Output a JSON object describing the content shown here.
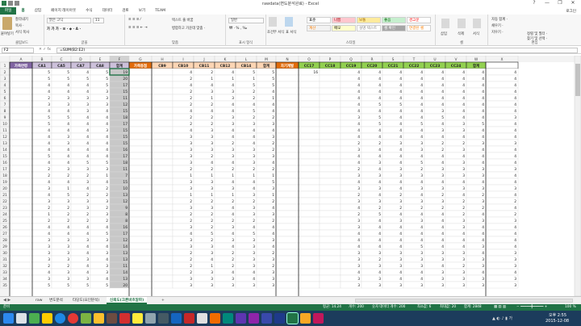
{
  "window": {
    "title": "rawdata(변도분석완료) - Excel",
    "qat_icons": [
      "save-icon",
      "undo-icon",
      "redo-icon"
    ],
    "controls": [
      "?",
      "—",
      "❐",
      "✕"
    ],
    "user": "로그인"
  },
  "menu": [
    "파일",
    "홈",
    "삽입",
    "페이지 레이아웃",
    "수식",
    "데이터",
    "검토",
    "보기",
    "TEAM"
  ],
  "ribbon": {
    "clipboard": {
      "label": "클립보드",
      "cut": "잘라내기",
      "copy": "복사 ·",
      "paste": "붙여넣기",
      "painter": "서식 복사"
    },
    "font": {
      "label": "글꼴",
      "name": "맑은 고딕",
      "size": "11"
    },
    "align": {
      "label": "맞춤",
      "wrap": "텍스트 줄 바꿈",
      "merge": "병합하고 가운데 맞춤 ·"
    },
    "number": {
      "label": "표시 형식",
      "format": "일반"
    },
    "styles": {
      "label": "스타일",
      "cond": "조건부 서식",
      "table": "표 서식",
      "cells": [
        {
          "text": "표준",
          "bg": "#ffffff",
          "fg": "#000000"
        },
        {
          "text": "나쁨",
          "bg": "#ffc7ce",
          "fg": "#9c0006"
        },
        {
          "text": "보통",
          "bg": "#ffeb9c",
          "fg": "#9c6500"
        },
        {
          "text": "좋음",
          "bg": "#c6efce",
          "fg": "#006100"
        },
        {
          "text": "경고문",
          "bg": "#ffffff",
          "fg": "#ff0000"
        },
        {
          "text": "계산",
          "bg": "#f2f2f2",
          "fg": "#fa7d00"
        },
        {
          "text": "메모",
          "bg": "#ffffcc",
          "fg": "#000000"
        },
        {
          "text": "설명 텍스트",
          "bg": "#ffffff",
          "fg": "#7f7f7f"
        },
        {
          "text": "셀 확인",
          "bg": "#a5a5a5",
          "fg": "#ffffff"
        },
        {
          "text": "연결된 셀",
          "bg": "#ffffff",
          "fg": "#fa7d00"
        }
      ]
    },
    "cells": {
      "label": "셀",
      "insert": "삽입",
      "delete": "삭제",
      "format": "서식"
    },
    "editing": {
      "label": "편집",
      "autosum": "자동 합계 ·",
      "fill": "채우기 ·",
      "clear": "지우기 ·",
      "sort": "정렬 및 필터 ·",
      "find": "찾기 및 선택 ·"
    }
  },
  "formula_bar": {
    "name_box": "F2",
    "formula": "=SUM(B2:E2)"
  },
  "grid": {
    "columns": [
      "A",
      "B",
      "C",
      "D",
      "E",
      "F",
      "G",
      "H",
      "I",
      "J",
      "K",
      "L",
      "M",
      "N",
      "O",
      "P",
      "Q",
      "R",
      "S",
      "T",
      "U",
      "V",
      "W",
      "X"
    ],
    "headers": [
      "가족연령",
      "CA1",
      "CA5",
      "CA7",
      "CA8",
      "합계",
      "가족동점",
      "CB9",
      "CB10",
      "CB11",
      "CB12",
      "CB14",
      "합계",
      "자기계발",
      "CC17",
      "CC18",
      "CC19",
      "CC20",
      "CC21",
      "CC22",
      "CC23",
      "CC24",
      "합계",
      ""
    ],
    "header_colors": [
      "#8064a2",
      "#ccc0da",
      "#ccc0da",
      "#ccc0da",
      "#ccc0da",
      "#ccc0da",
      "#e26b0a",
      "#fcd5b4",
      "#fcd5b4",
      "#fcd5b4",
      "#fcd5b4",
      "#fcd5b4",
      "#fcd5b4",
      "#e26b0a",
      "#92d050",
      "#92d050",
      "#92d050",
      "#92d050",
      "#92d050",
      "#92d050",
      "#92d050",
      "#92d050",
      "#92d050",
      "#ffffff"
    ],
    "row_numbers": [
      1,
      2,
      3,
      4,
      5,
      6,
      7,
      8,
      9,
      10,
      11,
      12,
      13,
      14,
      15,
      16,
      17,
      18,
      19,
      20,
      21,
      22,
      23,
      24,
      25,
      26,
      27,
      28,
      29,
      30,
      31,
      32,
      33,
      34,
      35
    ],
    "rows": [
      [
        "5",
        "5",
        "4",
        "5",
        "19",
        "",
        "4",
        "2",
        "4",
        "5",
        "5",
        "16",
        "",
        "4",
        "4",
        "4",
        "4",
        "4",
        "4",
        "4",
        "4",
        "10"
      ],
      [
        "5",
        "5",
        "5",
        "5",
        "20",
        "",
        "2",
        "1",
        "1",
        "1",
        "5",
        "",
        "",
        "4",
        "4",
        "4",
        "4",
        "4",
        "4",
        "4",
        "4",
        ""
      ],
      [
        "4",
        "4",
        "4",
        "5",
        "17",
        "",
        "4",
        "4",
        "4",
        "5",
        "5",
        "",
        "",
        "4",
        "4",
        "4",
        "4",
        "4",
        "4",
        "4",
        "4",
        ""
      ],
      [
        "4",
        "4",
        "4",
        "3",
        "15",
        "",
        "2",
        "3",
        "3",
        "2",
        "4",
        "",
        "",
        "4",
        "4",
        "4",
        "4",
        "4",
        "4",
        "4",
        "4",
        ""
      ],
      [
        "2",
        "3",
        "3",
        "3",
        "11",
        "",
        "2",
        "1",
        "3",
        "2",
        "1",
        "",
        "",
        "4",
        "4",
        "4",
        "4",
        "4",
        "4",
        "4",
        "4",
        ""
      ],
      [
        "3",
        "3",
        "3",
        "3",
        "12",
        "",
        "2",
        "2",
        "4",
        "4",
        "4",
        "",
        "",
        "4",
        "5",
        "5",
        "4",
        "4",
        "4",
        "4",
        "4",
        ""
      ],
      [
        "4",
        "4",
        "3",
        "4",
        "15",
        "",
        "4",
        "4",
        "4",
        "5",
        "4",
        "",
        "",
        "4",
        "4",
        "4",
        "4",
        "3",
        "4",
        "4",
        "4",
        ""
      ],
      [
        "5",
        "5",
        "4",
        "4",
        "18",
        "",
        "2",
        "2",
        "3",
        "2",
        "2",
        "",
        "",
        "3",
        "5",
        "4",
        "4",
        "5",
        "4",
        "4",
        "3",
        ""
      ],
      [
        "5",
        "4",
        "4",
        "4",
        "17",
        "",
        "2",
        "2",
        "3",
        "3",
        "3",
        "",
        "",
        "4",
        "5",
        "4",
        "5",
        "4",
        "3",
        "5",
        "4",
        ""
      ],
      [
        "4",
        "4",
        "4",
        "3",
        "15",
        "",
        "4",
        "3",
        "4",
        "4",
        "4",
        "",
        "",
        "4",
        "4",
        "4",
        "4",
        "3",
        "3",
        "4",
        "4",
        ""
      ],
      [
        "4",
        "3",
        "4",
        "4",
        "15",
        "",
        "3",
        "3",
        "4",
        "4",
        "3",
        "",
        "",
        "4",
        "4",
        "4",
        "4",
        "4",
        "4",
        "4",
        "4",
        ""
      ],
      [
        "4",
        "3",
        "4",
        "4",
        "15",
        "",
        "3",
        "3",
        "2",
        "4",
        "2",
        "",
        "",
        "2",
        "2",
        "3",
        "3",
        "2",
        "2",
        "3",
        "3",
        ""
      ],
      [
        "4",
        "4",
        "4",
        "4",
        "16",
        "",
        "3",
        "3",
        "3",
        "3",
        "2",
        "",
        "",
        "3",
        "4",
        "4",
        "3",
        "2",
        "3",
        "4",
        "4",
        ""
      ],
      [
        "5",
        "4",
        "4",
        "4",
        "17",
        "",
        "3",
        "2",
        "3",
        "3",
        "3",
        "",
        "",
        "4",
        "4",
        "4",
        "4",
        "4",
        "4",
        "4",
        "4",
        ""
      ],
      [
        "4",
        "4",
        "5",
        "5",
        "18",
        "",
        "3",
        "4",
        "4",
        "3",
        "4",
        "",
        "",
        "4",
        "3",
        "4",
        "5",
        "4",
        "3",
        "4",
        "4",
        ""
      ],
      [
        "2",
        "3",
        "3",
        "3",
        "11",
        "",
        "2",
        "2",
        "2",
        "2",
        "2",
        "",
        "",
        "2",
        "4",
        "3",
        "2",
        "3",
        "3",
        "3",
        "3",
        ""
      ],
      [
        "2",
        "2",
        "2",
        "1",
        "7",
        "",
        "1",
        "1",
        "1",
        "1",
        "1",
        "",
        "",
        "3",
        "3",
        "3",
        "3",
        "3",
        "3",
        "3",
        "4",
        ""
      ],
      [
        "4",
        "4",
        "3",
        "4",
        "15",
        "",
        "3",
        "3",
        "4",
        "4",
        "5",
        "",
        "",
        "4",
        "4",
        "4",
        "4",
        "4",
        "4",
        "4",
        "4",
        ""
      ],
      [
        "3",
        "1",
        "4",
        "2",
        "10",
        "",
        "3",
        "3",
        "3",
        "4",
        "3",
        "",
        "",
        "3",
        "3",
        "4",
        "3",
        "3",
        "3",
        "3",
        "3",
        ""
      ],
      [
        "4",
        "5",
        "2",
        "2",
        "13",
        "",
        "1",
        "1",
        "1",
        "3",
        "1",
        "",
        "",
        "2",
        "4",
        "2",
        "4",
        "2",
        "4",
        "2",
        "4",
        ""
      ],
      [
        "3",
        "3",
        "3",
        "3",
        "12",
        "",
        "2",
        "2",
        "2",
        "2",
        "2",
        "",
        "",
        "3",
        "3",
        "3",
        "3",
        "3",
        "2",
        "3",
        "2",
        ""
      ],
      [
        "2",
        "2",
        "3",
        "2",
        "9",
        "",
        "3",
        "3",
        "4",
        "3",
        "4",
        "",
        "",
        "4",
        "2",
        "2",
        "2",
        "2",
        "2",
        "2",
        "4",
        ""
      ],
      [
        "1",
        "2",
        "2",
        "3",
        "8",
        "",
        "2",
        "2",
        "4",
        "3",
        "3",
        "",
        "",
        "2",
        "5",
        "4",
        "4",
        "4",
        "2",
        "4",
        "2",
        ""
      ],
      [
        "2",
        "2",
        "2",
        "2",
        "8",
        "",
        "2",
        "2",
        "2",
        "2",
        "2",
        "",
        "",
        "3",
        "4",
        "3",
        "3",
        "4",
        "3",
        "3",
        "3",
        ""
      ],
      [
        "4",
        "4",
        "4",
        "4",
        "16",
        "",
        "3",
        "2",
        "3",
        "4",
        "4",
        "",
        "",
        "3",
        "4",
        "4",
        "4",
        "4",
        "3",
        "4",
        "4",
        ""
      ],
      [
        "4",
        "4",
        "4",
        "5",
        "17",
        "",
        "4",
        "5",
        "4",
        "5",
        "4",
        "",
        "",
        "4",
        "4",
        "4",
        "4",
        "4",
        "4",
        "4",
        "4",
        ""
      ],
      [
        "3",
        "3",
        "3",
        "3",
        "12",
        "",
        "3",
        "2",
        "3",
        "3",
        "3",
        "",
        "",
        "4",
        "4",
        "4",
        "4",
        "4",
        "4",
        "4",
        "4",
        ""
      ],
      [
        "3",
        "3",
        "4",
        "4",
        "14",
        "",
        "3",
        "3",
        "4",
        "3",
        "4",
        "",
        "",
        "4",
        "4",
        "4",
        "5",
        "4",
        "4",
        "3",
        "4",
        ""
      ],
      [
        "3",
        "3",
        "4",
        "3",
        "13",
        "",
        "2",
        "3",
        "2",
        "3",
        "2",
        "",
        "",
        "3",
        "3",
        "3",
        "3",
        "3",
        "3",
        "4",
        "3",
        ""
      ],
      [
        "3",
        "3",
        "3",
        "4",
        "13",
        "",
        "2",
        "4",
        "2",
        "3",
        "3",
        "",
        "",
        "3",
        "2",
        "3",
        "3",
        "3",
        "3",
        "3",
        "3",
        ""
      ],
      [
        "2",
        "2",
        "4",
        "3",
        "11",
        "",
        "2",
        "1",
        "2",
        "3",
        "2",
        "",
        "",
        "3",
        "3",
        "3",
        "3",
        "4",
        "2",
        "3",
        "3",
        ""
      ],
      [
        "4",
        "3",
        "4",
        "3",
        "14",
        "",
        "2",
        "3",
        "4",
        "4",
        "3",
        "",
        "",
        "4",
        "4",
        "4",
        "4",
        "3",
        "3",
        "4",
        "4",
        ""
      ],
      [
        "3",
        "3",
        "3",
        "4",
        "13",
        "",
        "3",
        "3",
        "3",
        "4",
        "3",
        "",
        "",
        "3",
        "3",
        "4",
        "4",
        "3",
        "3",
        "3",
        "3",
        ""
      ],
      [
        "5",
        "5",
        "5",
        "5",
        "20",
        "",
        "3",
        "3",
        "3",
        "3",
        "3",
        "",
        "",
        "3",
        "3",
        "3",
        "3",
        "3",
        "3",
        "3",
        "3",
        ""
      ]
    ]
  },
  "sheets": [
    "raw",
    "변도분석",
    "타당도(요인분석)",
    "신뢰도(크론바흐알파)",
    "+"
  ],
  "statusbar": {
    "mode": "준비",
    "average": "평균: 14.24",
    "count": "개수: 200",
    "numcount": "숫자 데이터 개수: 200",
    "min": "최소값: 6",
    "max": "최대값: 20",
    "sum": "합계: 2848",
    "zoom": "100 %"
  },
  "taskbar": {
    "time": "오후 2:55",
    "date": "2015-12-08"
  }
}
